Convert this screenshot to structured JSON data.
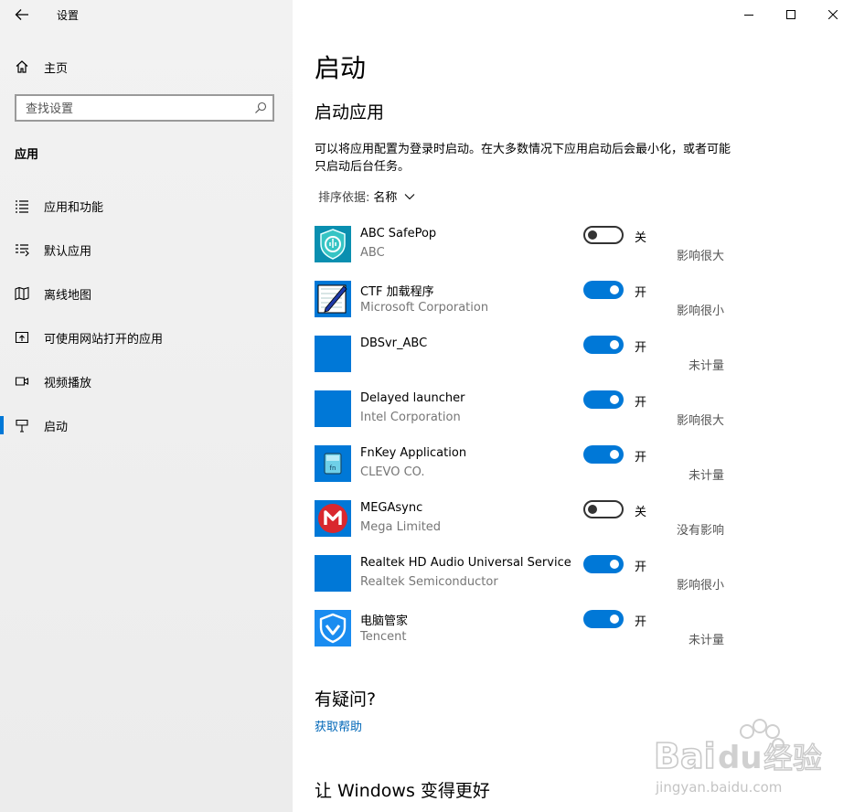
{
  "window": {
    "title": "设置"
  },
  "sidebar": {
    "home_label": "主页",
    "search_placeholder": "查找设置",
    "section": "应用",
    "items": [
      {
        "label": "应用和功能",
        "icon": "list-icon"
      },
      {
        "label": "默认应用",
        "icon": "default-apps-icon"
      },
      {
        "label": "离线地图",
        "icon": "map-icon"
      },
      {
        "label": "可使用网站打开的应用",
        "icon": "open-website-icon"
      },
      {
        "label": "视频播放",
        "icon": "video-icon"
      },
      {
        "label": "启动",
        "icon": "startup-icon",
        "selected": true
      }
    ]
  },
  "main": {
    "title": "启动",
    "subtitle": "启动应用",
    "description": "可以将应用配置为登录时启动。在大多数情况下应用启动后会最小化，或者可能只启动后台任务。",
    "sort_label": "排序依据:",
    "sort_value": "名称",
    "apps": [
      {
        "name": "ABC SafePop",
        "publisher": "ABC",
        "on": false,
        "state": "关",
        "impact": "影响很大",
        "icon": "shield-app-icon"
      },
      {
        "name": "CTF 加载程序",
        "publisher": "Microsoft Corporation",
        "on": true,
        "state": "开",
        "impact": "影响很小",
        "icon": "pen-notepad-icon"
      },
      {
        "name": "DBSvr_ABC",
        "publisher": "",
        "on": true,
        "state": "开",
        "impact": "未计量",
        "icon": "blank-app-icon"
      },
      {
        "name": "Delayed launcher",
        "publisher": "Intel Corporation",
        "on": true,
        "state": "开",
        "impact": "影响很大",
        "icon": "blank-app-icon"
      },
      {
        "name": "FnKey Application",
        "publisher": "CLEVO CO.",
        "on": true,
        "state": "开",
        "impact": "未计量",
        "icon": "fn-key-icon"
      },
      {
        "name": "MEGAsync",
        "publisher": "Mega Limited",
        "on": false,
        "state": "关",
        "impact": "没有影响",
        "icon": "mega-icon"
      },
      {
        "name": "Realtek HD Audio Universal Service",
        "publisher": "Realtek Semiconductor",
        "on": true,
        "state": "开",
        "impact": "影响很小",
        "icon": "blank-app-icon"
      },
      {
        "name": "电脑管家",
        "publisher": "Tencent",
        "on": true,
        "state": "开",
        "impact": "未计量",
        "icon": "tencent-shield-icon"
      }
    ],
    "help_title": "有疑问?",
    "help_link": "获取帮助",
    "improve_title": "让 Windows 变得更好"
  },
  "watermark": {
    "brand": "Baidu经验",
    "url": "jingyan.baidu.com"
  },
  "colors": {
    "accent": "#0078d7",
    "link": "#0067b8",
    "sidebar_bg": "#f2f2f2"
  }
}
